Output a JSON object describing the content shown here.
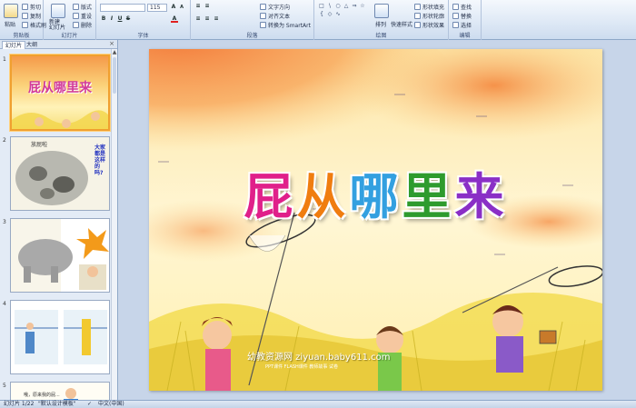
{
  "ribbon": {
    "clipboard": {
      "paste": "粘贴",
      "cut": "剪切",
      "copy": "复制",
      "format_painter": "格式刷",
      "label": "剪贴板"
    },
    "slides": {
      "new_slide": "新建\n幻灯片",
      "layout": "版式",
      "reset": "重设",
      "delete": "删除",
      "label": "幻灯片"
    },
    "font": {
      "font_size": "115",
      "bold": "B",
      "italic": "I",
      "underline": "U",
      "strike": "S",
      "label": "字体"
    },
    "paragraph": {
      "text_direction": "文字方向",
      "align_text": "对齐文本",
      "smartart": "转换为 SmartArt",
      "label": "段落"
    },
    "drawing": {
      "arrange": "排列",
      "quick_styles": "快速样式",
      "shape_fill": "形状填充",
      "shape_outline": "形状轮廓",
      "shape_effects": "形状效果",
      "label": "绘图"
    },
    "editing": {
      "find": "查找",
      "replace": "替换",
      "select": "选择",
      "label": "编辑"
    }
  },
  "panel": {
    "tab_slides": "幻灯片",
    "tab_outline": "大纲",
    "close": "×",
    "thumbs": [
      {
        "num": "1",
        "title": "屁从哪里来"
      },
      {
        "num": "2",
        "title": "放屁啦",
        "side_text": "大家都是这样的吗?"
      },
      {
        "num": "3"
      },
      {
        "num": "4"
      },
      {
        "num": "5",
        "caption": "哦，原来我的屁..."
      }
    ]
  },
  "slide": {
    "title_chars": [
      "屁",
      "从",
      "哪",
      "里",
      "来"
    ],
    "title_colors": [
      "#e0208a",
      "#f07d10",
      "#33a0e0",
      "#2e9b2e",
      "#8a2fc6"
    ],
    "watermark": "幼教资源网 ziyuan.baby611.com",
    "watermark_sub": "PPT课件  FLASH课件  教师故事  试卷"
  },
  "status": {
    "slide_info": "幻灯片 1/22",
    "theme": "\"默认设计模板\"",
    "language": "中文(中国)"
  }
}
